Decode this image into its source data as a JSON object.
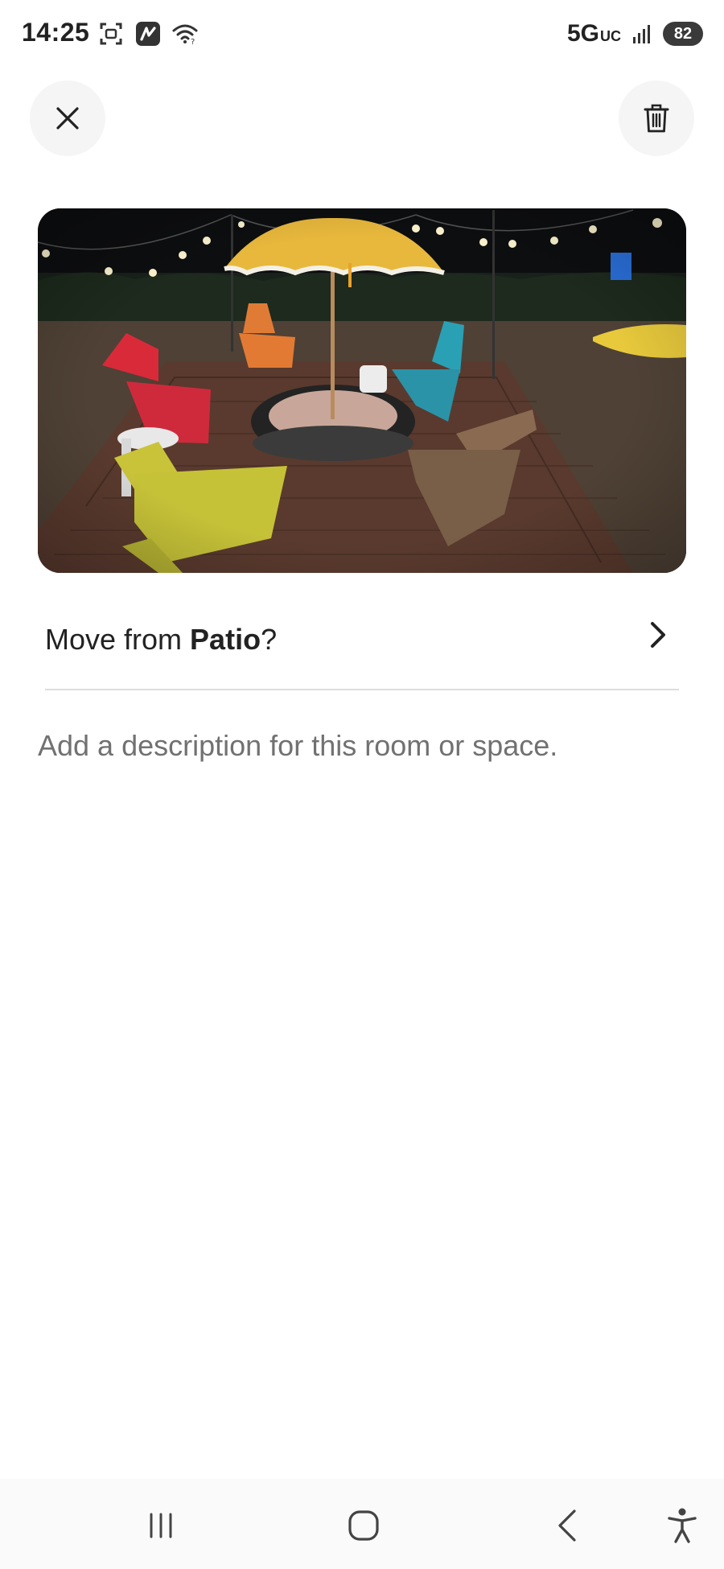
{
  "status_bar": {
    "time": "14:25",
    "network": "5G",
    "network_suffix": "UC",
    "battery": "82",
    "icons": [
      "screenshot-icon",
      "app-notification-icon",
      "wifi-icon",
      "signal-icon"
    ]
  },
  "toolbar": {
    "close_icon": "close-icon",
    "delete_icon": "trash-icon"
  },
  "photo": {
    "subject": "patio-photo"
  },
  "move_row": {
    "prefix": "Move from ",
    "room": "Patio",
    "suffix": "?",
    "icon": "chevron-right-icon"
  },
  "description": {
    "placeholder": "Add a description for this room or space.",
    "value": ""
  },
  "nav_bar": {
    "icons": [
      "recent-apps-icon",
      "home-icon",
      "back-icon",
      "accessibility-icon"
    ]
  },
  "colors": {
    "text_primary": "#222222",
    "text_secondary": "#717171",
    "button_bg": "#f5f5f5",
    "divider": "#dddddd"
  }
}
